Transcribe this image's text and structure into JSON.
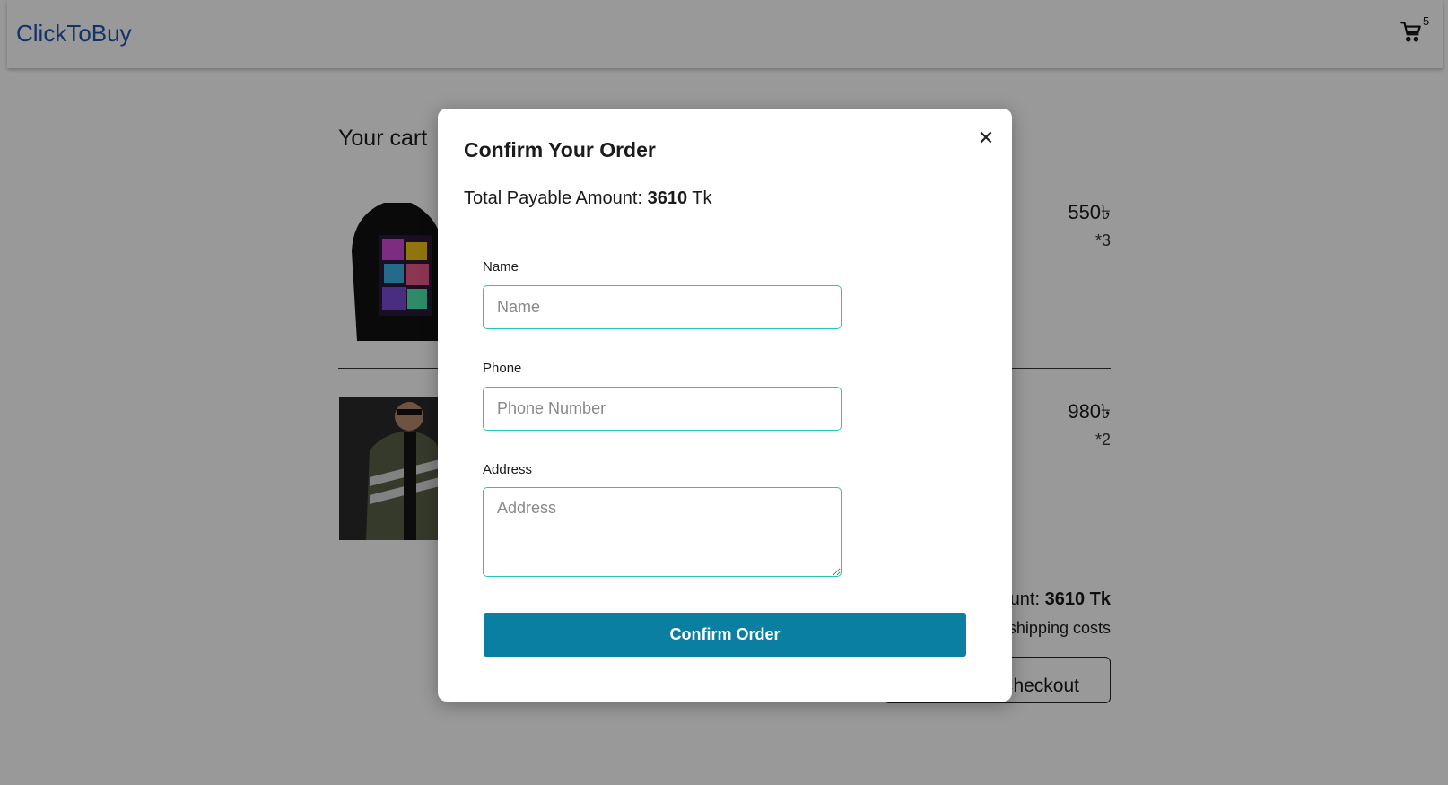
{
  "navbar": {
    "brand": "ClickToBuy",
    "cart_icon": "cart-icon",
    "cart_count": "5",
    "brand_color": "#1e56b0"
  },
  "cart": {
    "title": "Your cart",
    "items": [
      {
        "price": "550৳",
        "qty": "*3",
        "image": "black-hoodie-graphic-print"
      },
      {
        "price": "980৳",
        "qty": "*2",
        "image": "man-olive-jacket-sunglasses"
      }
    ],
    "summary_amount_prefix": "unt: ",
    "summary_amount_value": "3610 Tk",
    "summary_note": "shipping costs",
    "checkout_label": "Checkout"
  },
  "modal": {
    "title": "Confirm Your Order",
    "close_icon": "close-icon",
    "total_label": "Total Payable Amount: ",
    "total_value": "3610",
    "total_currency": " Tk",
    "fields": {
      "name_label": "Name",
      "name_placeholder": "Name",
      "phone_label": "Phone",
      "phone_placeholder": "Phone Number",
      "address_label": "Address",
      "address_placeholder": "Address"
    },
    "confirm_label": "Confirm Order",
    "accent_color": "#0b7fa1",
    "input_border_color": "#24c6b6"
  }
}
